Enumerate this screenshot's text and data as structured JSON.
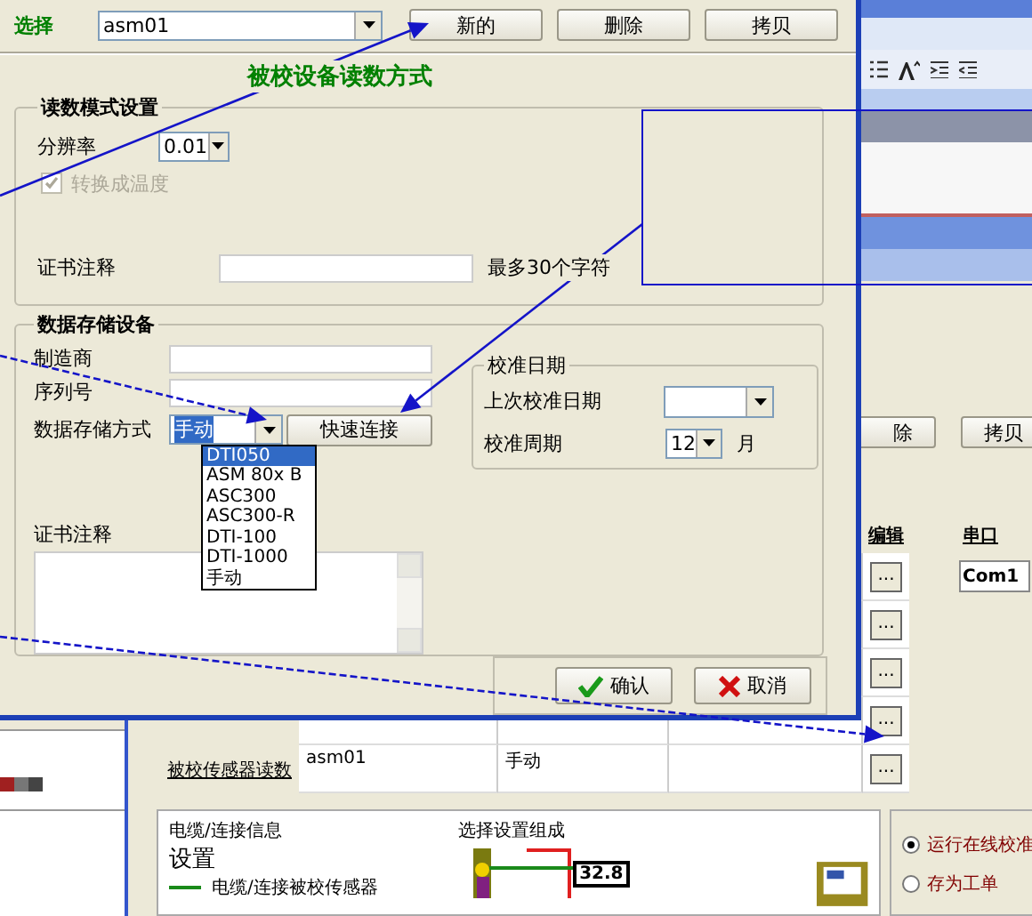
{
  "dialog": {
    "select_label": "选择",
    "select_value": "asm01",
    "top_buttons": [
      "新的",
      "删除",
      "拷贝"
    ],
    "title": "被校设备读数方式",
    "reading_mode": {
      "legend": "读数模式设置",
      "resolution_label": "分辨率",
      "resolution_value": "0.01",
      "convert": {
        "label": "转换成温度",
        "checked": true,
        "disabled": true
      },
      "note_label": "证书注释",
      "note_hint": "最多30个字符"
    },
    "storage": {
      "legend": "数据存储设备",
      "fields": [
        {
          "label": "制造商"
        },
        {
          "label": "序列号"
        }
      ],
      "method_label": "数据存储方式",
      "method_value": "手动",
      "quick_button": "快速连接",
      "options": [
        {
          "label": "DTI050",
          "selected": true
        },
        {
          "label": "ASM 80x B",
          "selected": false
        },
        {
          "label": "ASC300",
          "selected": false
        },
        {
          "label": "ASC300-R",
          "selected": false
        },
        {
          "label": "DTI-100",
          "selected": false
        },
        {
          "label": "DTI-1000",
          "selected": false
        },
        {
          "label": "手动",
          "selected": false
        }
      ],
      "note_label": "证书注释"
    },
    "calibration": {
      "legend": "校准日期",
      "last_label": "上次校准日期",
      "period_label": "校准周期",
      "period_value": "12",
      "period_unit": "月"
    },
    "buttons": [
      {
        "label": "确认",
        "kind": "ok"
      },
      {
        "label": "取消",
        "kind": "cancel"
      }
    ]
  },
  "background": {
    "buttons": [
      "除",
      "拷贝"
    ],
    "columns": [
      "编辑",
      "串口"
    ],
    "rows": [
      {
        "edit": "...",
        "port": "Com1"
      },
      {
        "edit": "..."
      },
      {
        "edit": "..."
      },
      {
        "edit": "..."
      },
      {
        "label": "被校传感器读数",
        "cells": [
          "asm01",
          "手动"
        ],
        "edit": "..."
      }
    ],
    "info": {
      "title": "电缆/连接信息",
      "subtitle": "设置",
      "legend": "电缆/连接被校传感器"
    },
    "diagram": {
      "title": "选择设置组成",
      "reading": "32.8"
    },
    "run_options": [
      {
        "label": "运行在线校准",
        "selected": true
      },
      {
        "label": "存为工单",
        "selected": false
      }
    ]
  }
}
